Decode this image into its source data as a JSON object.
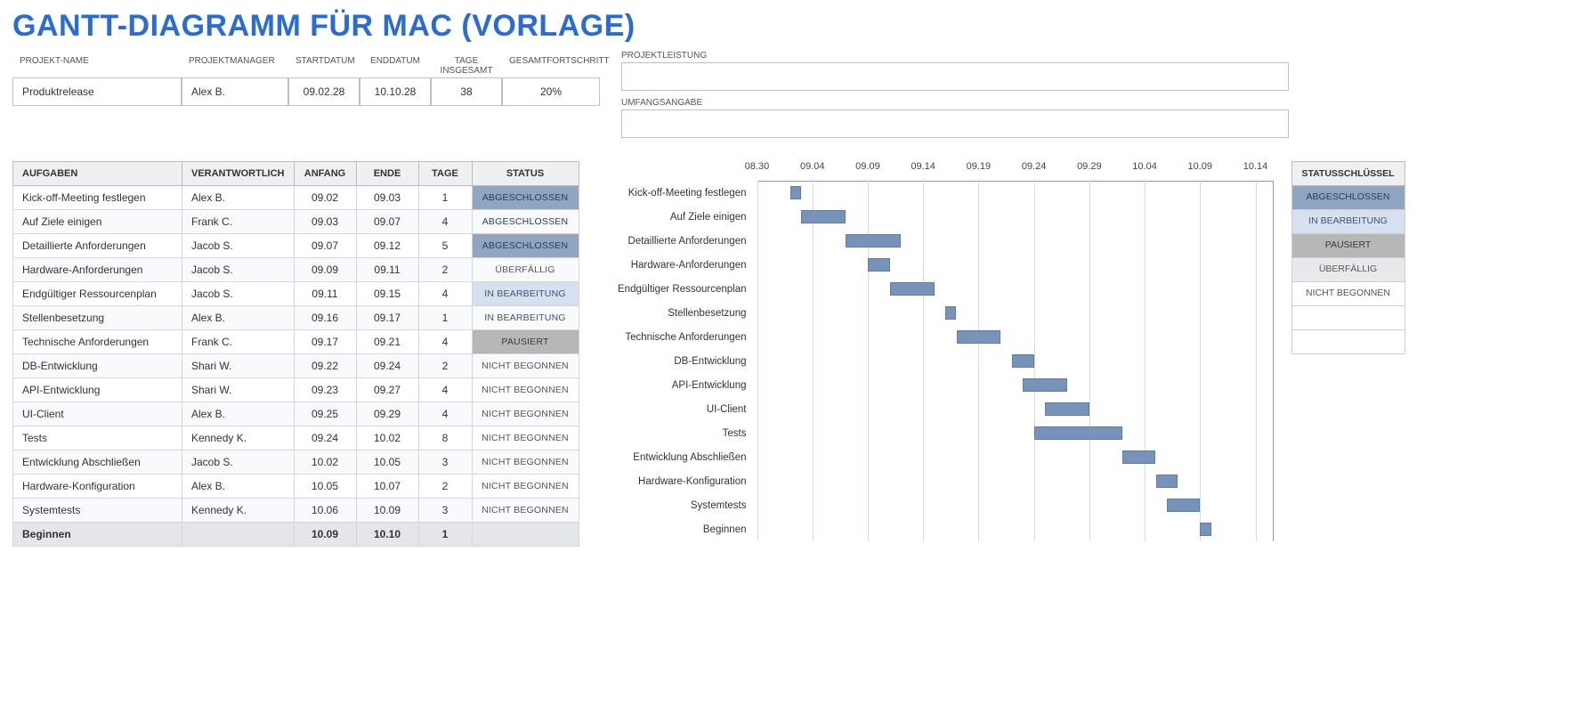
{
  "title": "GANTT-DIAGRAMM FÜR MAC (VORLAGE)",
  "meta": {
    "headers": {
      "project_name": "PROJEKT-NAME",
      "project_manager": "PROJEKTMANAGER",
      "start_date": "STARTDATUM",
      "end_date": "ENDDATUM",
      "total_days": "TAGE\nINSGESAMT",
      "overall_progress": "GESAMTFORTSCHRITT",
      "project_performance": "PROJEKTLEISTUNG",
      "scope_statement": "UMFANGSANGABE"
    },
    "values": {
      "project_name": "Produktrelease",
      "project_manager": "Alex B.",
      "start_date": "09.02.28",
      "end_date": "10.10.28",
      "total_days": "38",
      "overall_progress": "20%"
    }
  },
  "task_table": {
    "headers": {
      "task": "AUFGABEN",
      "responsible": "VERANTWORTLICH",
      "start": "ANFANG",
      "end": "ENDE",
      "days": "TAGE",
      "status": "STATUS"
    },
    "rows": [
      {
        "task": "Kick-off-Meeting festlegen",
        "responsible": "Alex B.",
        "start": "09.02",
        "end": "09.03",
        "days": "1",
        "status": "ABGESCHLOSSEN"
      },
      {
        "task": "Auf Ziele einigen",
        "responsible": "Frank C.",
        "start": "09.03",
        "end": "09.07",
        "days": "4",
        "status": "ABGESCHLOSSEN"
      },
      {
        "task": "Detaillierte Anforderungen",
        "responsible": "Jacob S.",
        "start": "09.07",
        "end": "09.12",
        "days": "5",
        "status": "ABGESCHLOSSEN"
      },
      {
        "task": "Hardware-Anforderungen",
        "responsible": "Jacob S.",
        "start": "09.09",
        "end": "09.11",
        "days": "2",
        "status": "ÜBERFÄLLIG"
      },
      {
        "task": "Endgültiger Ressourcenplan",
        "responsible": "Jacob S.",
        "start": "09.11",
        "end": "09.15",
        "days": "4",
        "status": "IN BEARBEITUNG"
      },
      {
        "task": "Stellenbesetzung",
        "responsible": "Alex B.",
        "start": "09.16",
        "end": "09.17",
        "days": "1",
        "status": "IN BEARBEITUNG"
      },
      {
        "task": "Technische Anforderungen",
        "responsible": "Frank C.",
        "start": "09.17",
        "end": "09.21",
        "days": "4",
        "status": "PAUSIERT"
      },
      {
        "task": "DB-Entwicklung",
        "responsible": "Shari W.",
        "start": "09.22",
        "end": "09.24",
        "days": "2",
        "status": "NICHT BEGONNEN"
      },
      {
        "task": "API-Entwicklung",
        "responsible": "Shari W.",
        "start": "09.23",
        "end": "09.27",
        "days": "4",
        "status": "NICHT BEGONNEN"
      },
      {
        "task": "UI-Client",
        "responsible": "Alex B.",
        "start": "09.25",
        "end": "09.29",
        "days": "4",
        "status": "NICHT BEGONNEN"
      },
      {
        "task": "Tests",
        "responsible": "Kennedy K.",
        "start": "09.24",
        "end": "10.02",
        "days": "8",
        "status": "NICHT BEGONNEN"
      },
      {
        "task": "Entwicklung Abschließen",
        "responsible": "Jacob S.",
        "start": "10.02",
        "end": "10.05",
        "days": "3",
        "status": "NICHT BEGONNEN"
      },
      {
        "task": "Hardware-Konfiguration",
        "responsible": "Alex B.",
        "start": "10.05",
        "end": "10.07",
        "days": "2",
        "status": "NICHT BEGONNEN"
      },
      {
        "task": "Systemtests",
        "responsible": "Kennedy K.",
        "start": "10.06",
        "end": "10.09",
        "days": "3",
        "status": "NICHT BEGONNEN"
      }
    ],
    "footer": {
      "task": "Beginnen",
      "start": "10.09",
      "end": "10.10",
      "days": "1"
    }
  },
  "status_key": {
    "header": "STATUSSCHLÜSSEL",
    "items": [
      "ABGESCHLOSSEN",
      "IN BEARBEITUNG",
      "PAUSIERT",
      "ÜBERFÄLLIG",
      "NICHT BEGONNEN",
      "",
      ""
    ]
  },
  "chart_data": {
    "type": "bar",
    "orientation": "horizontal-gantt",
    "x_axis_ticks": [
      "08.30",
      "09.04",
      "09.09",
      "09.14",
      "09.19",
      "09.24",
      "09.29",
      "10.04",
      "10.09",
      "10.14"
    ],
    "x_range_days": [
      0,
      45
    ],
    "day0_label": "08.30",
    "series": [
      {
        "name": "Kick-off-Meeting festlegen",
        "start_day": 3,
        "duration": 1
      },
      {
        "name": "Auf Ziele einigen",
        "start_day": 4,
        "duration": 4
      },
      {
        "name": "Detaillierte Anforderungen",
        "start_day": 8,
        "duration": 5
      },
      {
        "name": "Hardware-Anforderungen",
        "start_day": 10,
        "duration": 2
      },
      {
        "name": "Endgültiger Ressourcenplan",
        "start_day": 12,
        "duration": 4
      },
      {
        "name": "Stellenbesetzung",
        "start_day": 17,
        "duration": 1
      },
      {
        "name": "Technische Anforderungen",
        "start_day": 18,
        "duration": 4
      },
      {
        "name": "DB-Entwicklung",
        "start_day": 23,
        "duration": 2
      },
      {
        "name": "API-Entwicklung",
        "start_day": 24,
        "duration": 4
      },
      {
        "name": "UI-Client",
        "start_day": 26,
        "duration": 4
      },
      {
        "name": "Tests",
        "start_day": 25,
        "duration": 8
      },
      {
        "name": "Entwicklung Abschließen",
        "start_day": 33,
        "duration": 3
      },
      {
        "name": "Hardware-Konfiguration",
        "start_day": 36,
        "duration": 2
      },
      {
        "name": "Systemtests",
        "start_day": 37,
        "duration": 3
      },
      {
        "name": "Beginnen",
        "start_day": 40,
        "duration": 1
      }
    ],
    "bar_color": "#7793b8"
  }
}
